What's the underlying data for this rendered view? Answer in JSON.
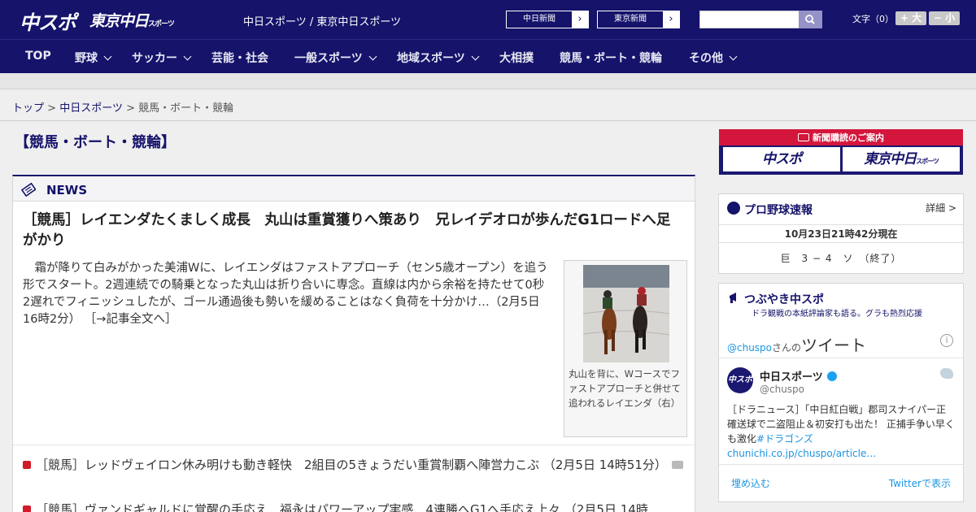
{
  "header": {
    "logo_chuspo": "中スポ",
    "logo_tokyo": "東京中日",
    "logo_tokyo_sub": "スポーツ",
    "tagline": "中日スポーツ / 東京中日スポーツ",
    "paper_links": [
      "中日新聞",
      "東京新聞"
    ],
    "search_placeholder": "",
    "font_label": "文字（0）",
    "font_larger": "+ 大",
    "font_smaller": "− 小"
  },
  "nav": {
    "items": [
      {
        "label": "TOP",
        "has_menu": false
      },
      {
        "label": "野球",
        "has_menu": true
      },
      {
        "label": "サッカー",
        "has_menu": true
      },
      {
        "label": "芸能・社会",
        "has_menu": false
      },
      {
        "label": "一般スポーツ",
        "has_menu": true
      },
      {
        "label": "地域スポーツ",
        "has_menu": true
      },
      {
        "label": "大相撲",
        "has_menu": false
      },
      {
        "label": "競馬・ボート・競輪",
        "has_menu": false
      },
      {
        "label": "その他",
        "has_menu": true
      }
    ]
  },
  "breadcrumb": {
    "top": "トップ",
    "section": "中日スポーツ",
    "current": "競馬・ボート・競輪",
    "sep": ">"
  },
  "page_title": "【競馬・ボート・競輪】",
  "news": {
    "label": "NEWS",
    "headline": "［競馬］レイエンダたくましく成長　丸山は重賞獲りへ策あり　兄レイデオロが歩んだG1ロードへ足がかり",
    "lead": "　霜が降りて白みがかった美浦Wに、レイエンダはファストアプローチ（セン5歳オープン）を追う形でスタート。2週連続での騎乗となった丸山は折り合いに専念。直線は内から余裕を持たせて0秒2遅れでフィニッシュしたが、ゴール通過後も勢いを緩めることはなく負荷を十分かけ…（2月5日 16時2分）",
    "read_more": "［→記事全文へ］",
    "photo_caption": "丸山を背に、Wコースでファストアプローチと併せて追われるレイエンダ（右）",
    "list": [
      {
        "text": "［競馬］レッドヴェイロン休み明けも動き軽快　2組目の5きょうだい重賞制覇へ陣営力こぶ （2月5日 14時51分）",
        "has_photo": true
      },
      {
        "text": "［競馬］ヴァンドギャルドに覚醒の手応え　福永はパワーアップ実感　4連勝へG1へ手応え上々 （2月5日 14時",
        "has_photo": false
      }
    ]
  },
  "subscription": {
    "title": "新聞購読のご案内",
    "chuspo": "中スポ",
    "tokyo": "東京中日",
    "tokyo_sub": "スポーツ"
  },
  "baseball": {
    "title": "プロ野球速報",
    "more": "詳細 >",
    "time": "10月23日21時42分現在",
    "score": "巨　3 − 4　ソ　（終了）"
  },
  "twitter": {
    "title": "つぶやき中スポ",
    "subtitle": "ドラ観戦の本紙評論家も語る。グラも熱烈応援",
    "handle": "@chuspo",
    "handle_suffix": "さんの",
    "tweets_label": "ツイート",
    "account_name": "中日スポーツ",
    "account_id": "@chuspo",
    "avatar_text": "中スポ",
    "tweet_text": "［ドラニュース］「中日紅白戦」郡司スナイパー正確送球で二盗阻止＆初安打も出た！ 正捕手争い早くも激化",
    "tweet_hashtag": "#ドラゴンズ",
    "tweet_link": "chunichi.co.jp/chuspo/article…",
    "embed": "埋め込む",
    "view_on_twitter": "Twitterで表示"
  },
  "colors": {
    "brand_navy": "#15136a",
    "accent_red": "#d4163c",
    "twitter_blue": "#1b95e0"
  }
}
